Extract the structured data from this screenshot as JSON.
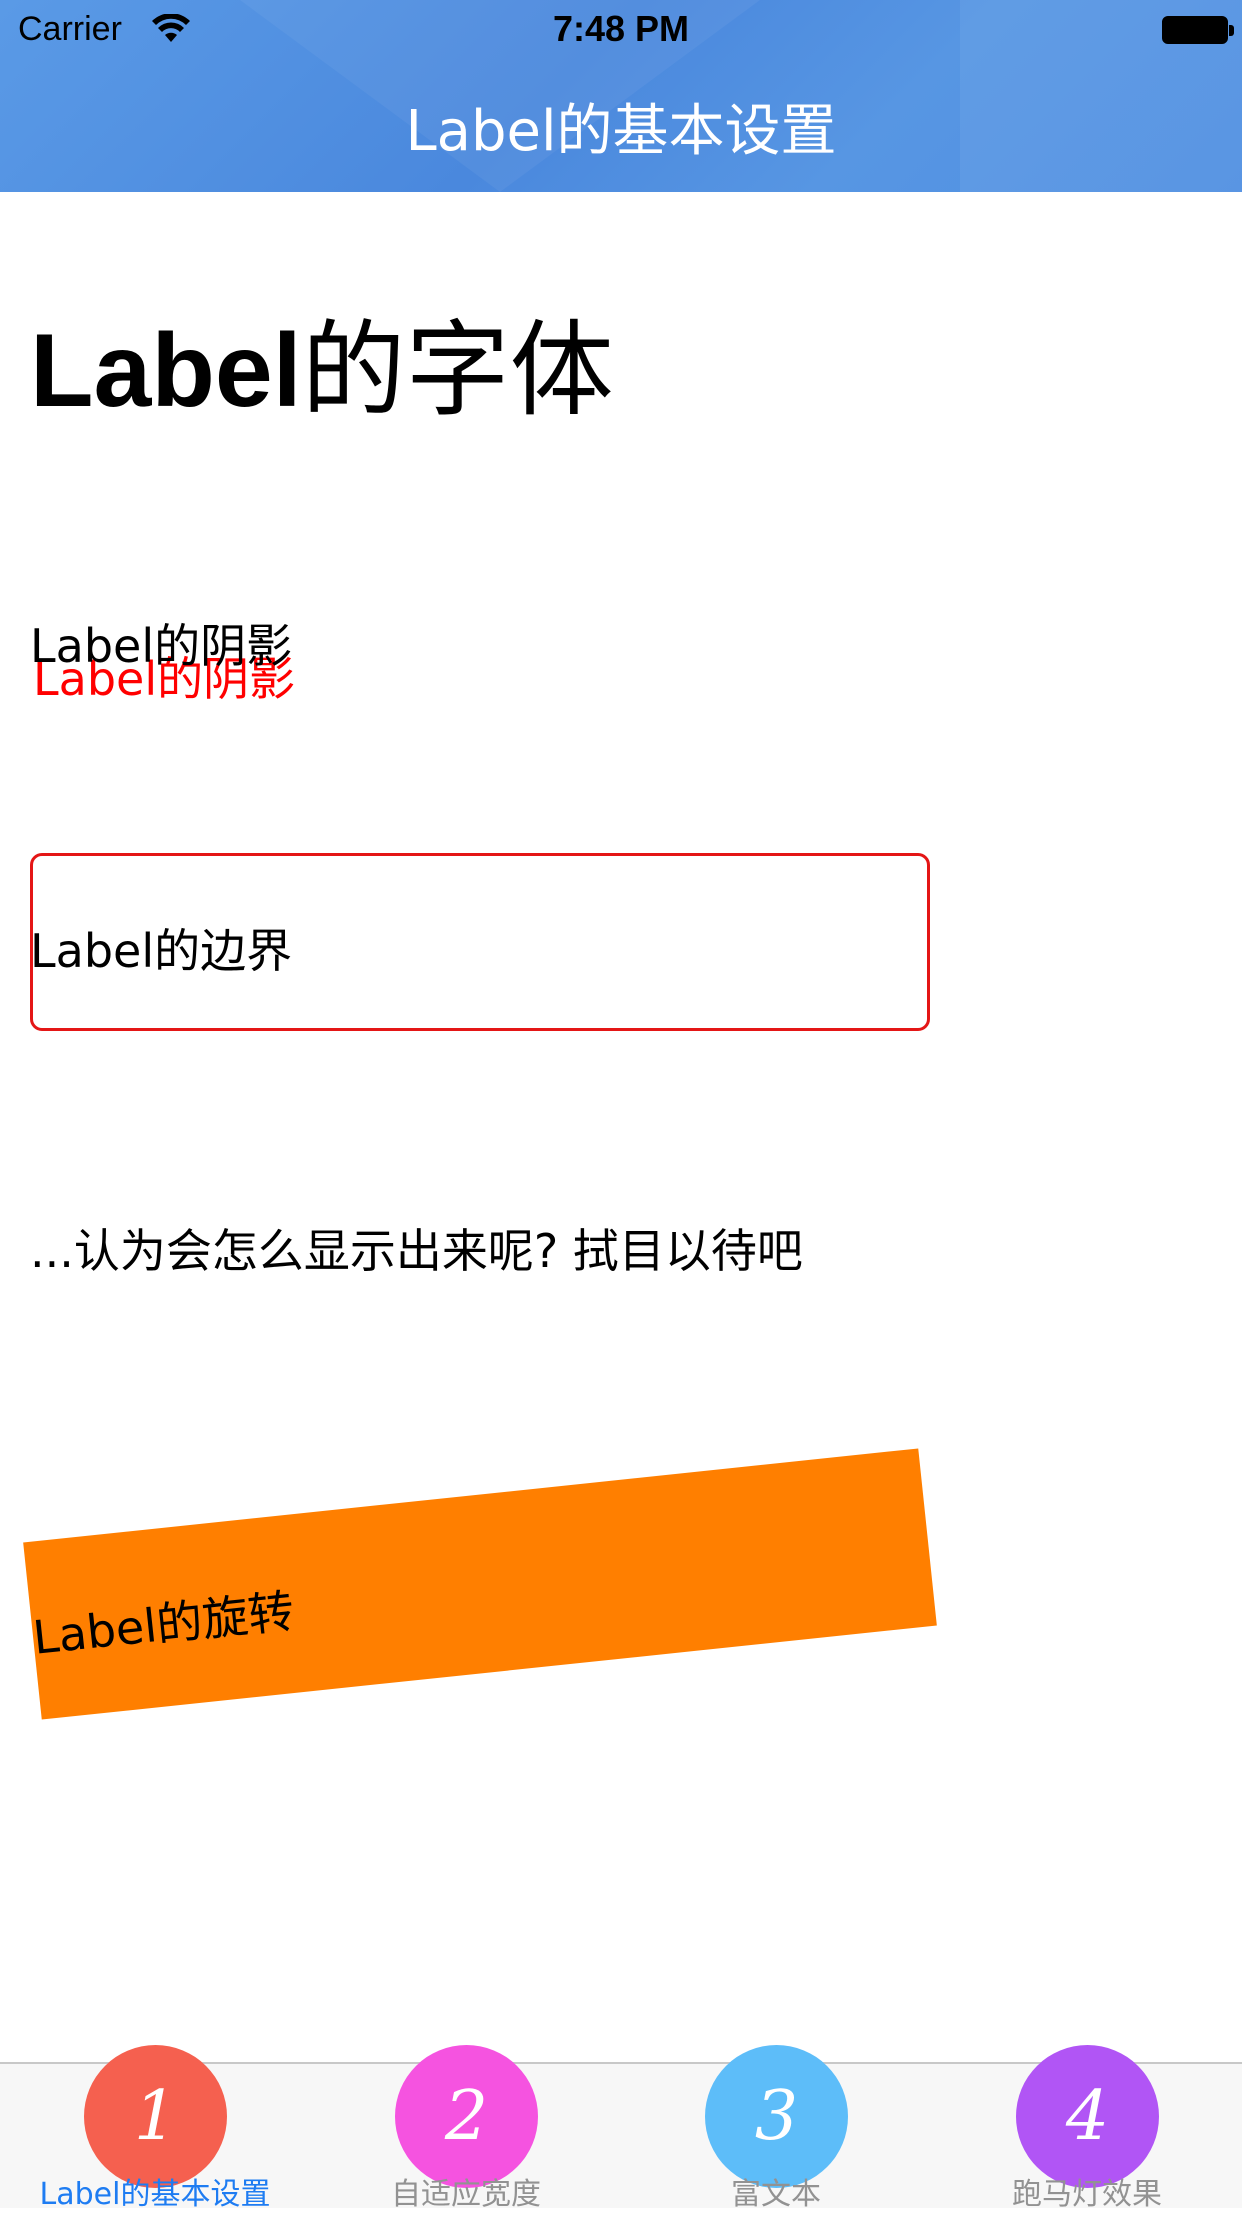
{
  "status_bar": {
    "carrier": "Carrier",
    "time": "7:48 PM"
  },
  "nav": {
    "title": "Label的基本设置"
  },
  "content": {
    "font_label_latin": "Label",
    "font_label_cjk": "的字体",
    "shadow_label": "Label的阴影",
    "border_label": "Label的边界",
    "truncated_label": "...认为会怎么显示出来呢? 拭目以待吧",
    "rotate_label": "Label的旋转"
  },
  "tabs": [
    {
      "number": "1",
      "label": "Label的基本设置",
      "color": "#f5604f",
      "active": true
    },
    {
      "number": "2",
      "label": "自适应宽度",
      "color": "#f553e0",
      "active": false
    },
    {
      "number": "3",
      "label": "富文本",
      "color": "#5dbdf9",
      "active": false
    },
    {
      "number": "4",
      "label": "跑马灯效果",
      "color": "#b155f5",
      "active": false
    }
  ],
  "colors": {
    "nav_blue": "#4a88dd",
    "shadow_red": "#ff0000",
    "border_red": "#e41616",
    "rotate_orange": "#ff7f00",
    "tab_active": "#1e7cf2",
    "tab_inactive": "#929292"
  },
  "icons": [
    "wifi-icon",
    "battery-icon"
  ]
}
